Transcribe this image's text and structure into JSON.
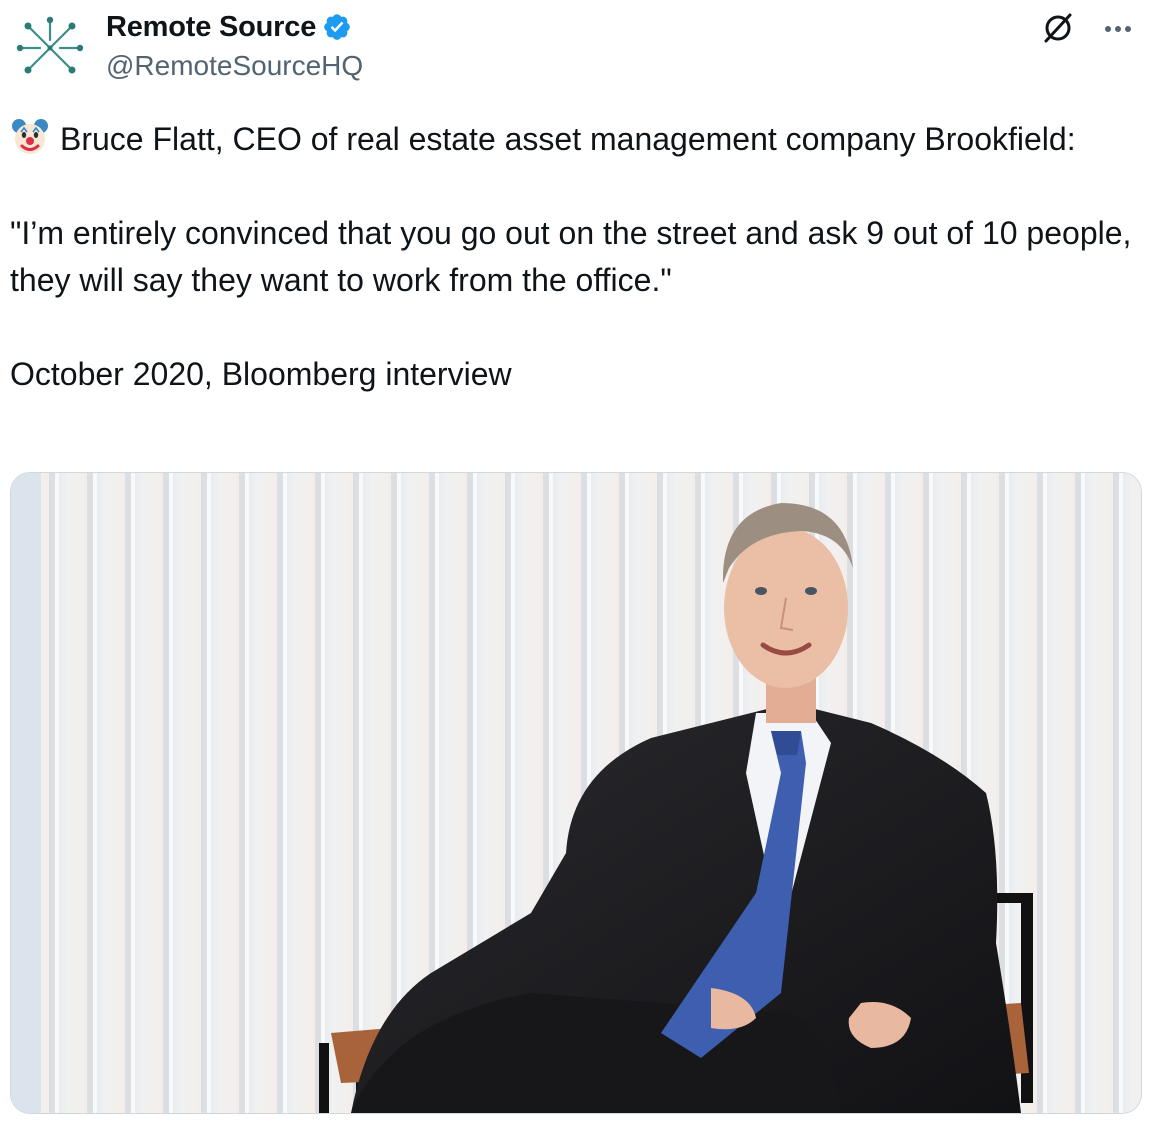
{
  "author": {
    "display_name": "Remote Source",
    "handle": "@RemoteSourceHQ",
    "verified": true,
    "avatar_icon": "network-node-logo",
    "accent_color": "#1d9bf0"
  },
  "actions": {
    "grok_icon": "grok-icon",
    "more_icon": "more-horizontal-icon"
  },
  "tweet": {
    "emoji": "clown-face-emoji",
    "line1": "Bruce Flatt, CEO of real estate asset management company Brookfield:",
    "quote": "\"I’m entirely convinced that you go out on the street and ask 9 out of 10 people, they will say they want to work from the office.\"",
    "source": "October 2020, Bloomberg interview"
  },
  "media": {
    "type": "photo",
    "subject": "man in dark suit and blue tie seated in a chair against a vertical slatted wall"
  }
}
